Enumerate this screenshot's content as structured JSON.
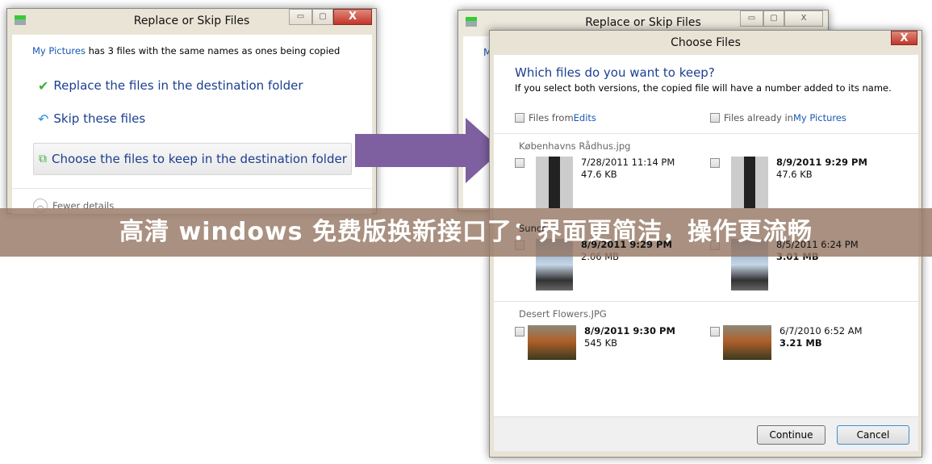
{
  "dialog1": {
    "title": "Replace or Skip Files",
    "source_link": "My Pictures",
    "message": " has 3 files with the same names as ones being copied",
    "options": [
      "Replace the files in the destination folder",
      "Skip these files",
      "Choose the files to keep in the destination folder"
    ],
    "fewer_details": "Fewer details",
    "ctl": {
      "min": "▭",
      "max": "▢",
      "close": "X"
    }
  },
  "dialog2_bg": {
    "title": "Replace or Skip Files",
    "partial": "M"
  },
  "choose": {
    "title": "Choose Files",
    "heading": "Which files do you want to keep?",
    "subtext": "If you select both versions, the copied file will have a number added to its name.",
    "left_header_prefix": "Files from ",
    "left_header_link": "Edits",
    "right_header_prefix": "Files already in ",
    "right_header_link": "My Pictures",
    "files": [
      {
        "name": "Københavns Rådhus.jpg",
        "left": {
          "date": "7/28/2011 11:14 PM",
          "size": "47.6 KB"
        },
        "right": {
          "date": "8/9/2011 9:29 PM",
          "size": "47.6 KB"
        }
      },
      {
        "name": "Suncr",
        "left": {
          "date": "8/9/2011 9:29 PM",
          "size": "2.06 MB"
        },
        "right": {
          "date": "8/5/2011 6:24 PM",
          "size": "3.01 MB"
        }
      },
      {
        "name": "Desert Flowers.JPG",
        "left": {
          "date": "8/9/2011 9:30 PM",
          "size": "545 KB"
        },
        "right": {
          "date": "6/7/2010 6:52 AM",
          "size": "3.21 MB"
        }
      }
    ],
    "continue": "Continue",
    "cancel": "Cancel",
    "close": "X"
  },
  "banner": "高清 windows 免费版换新接口了：界面更简洁，操作更流畅",
  "colors": {
    "arrow": "#7e5fa0",
    "link": "#1a58b5",
    "option": "#1b3f8f"
  }
}
